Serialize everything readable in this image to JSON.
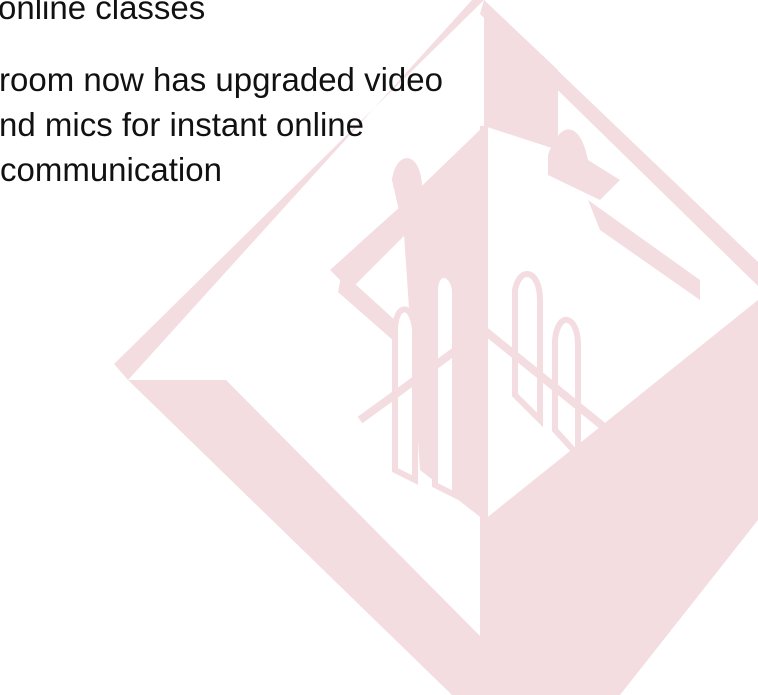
{
  "slide": {
    "lines": [
      "online classes",
      "room now has upgraded video",
      "nd mics for instant online",
      "communication"
    ]
  },
  "watermark": {
    "icon": "building-logo-icon",
    "color": "#f3dde1"
  }
}
